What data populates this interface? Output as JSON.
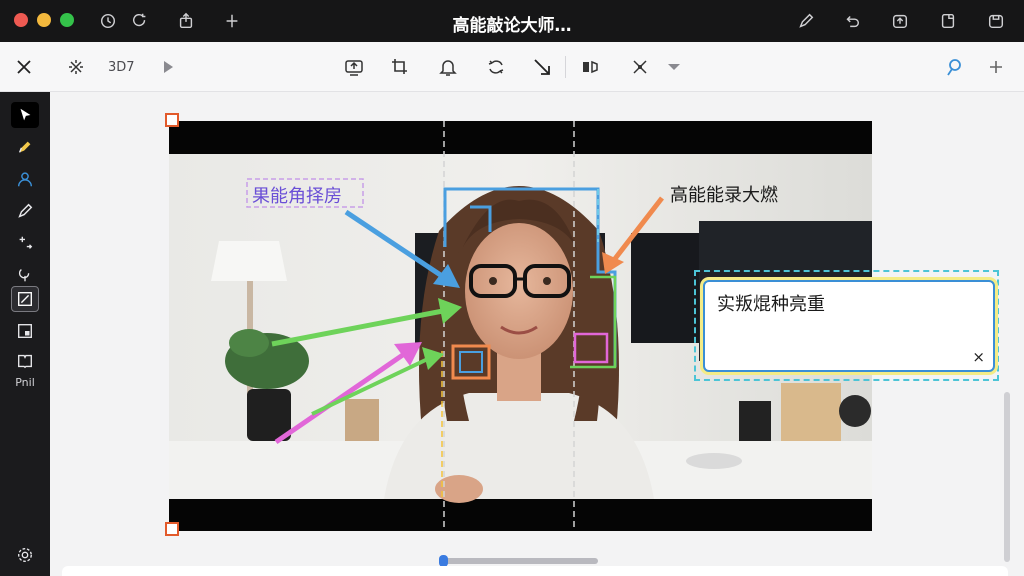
{
  "window": {
    "title": "高能敲论大师…",
    "traffic_lights": {
      "close": "#ee5a52",
      "minimize": "#f3b83d",
      "maximize": "#34c24a"
    }
  },
  "toolbar": {
    "view_label": "3D7"
  },
  "sidebar": {
    "bottom_label": "Pnil"
  },
  "annotations": {
    "label_left": "果能角择房",
    "label_right": "高能能录大燃",
    "callout_text": "实叛焜种亮重",
    "callout_close": "×"
  },
  "colors": {
    "accent_blue": "#3a8fd6",
    "handle_orange": "#e25a2b",
    "arrow_blue": "#4a9fe0",
    "arrow_green": "#6ed35a",
    "arrow_pink": "#e167d8",
    "arrow_orange": "#f08a4e",
    "label_purple": "#6a4fd6"
  }
}
